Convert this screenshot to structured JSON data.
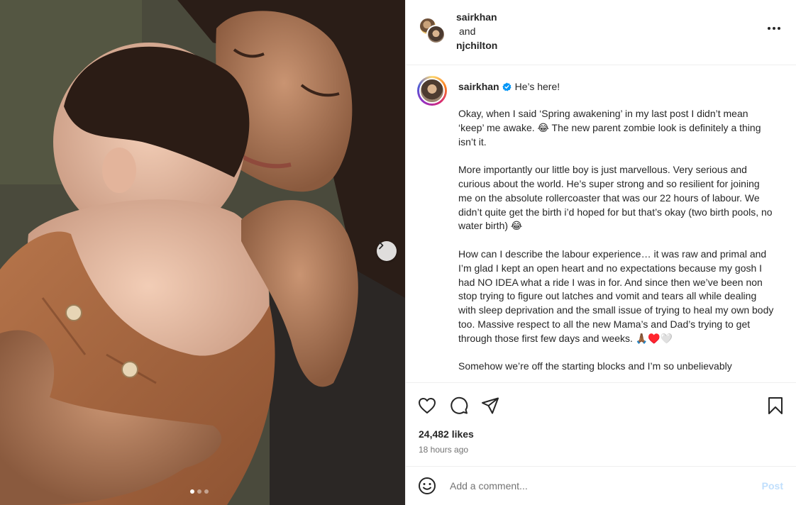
{
  "media": {
    "carousel_pages": 3,
    "current_page": 1
  },
  "header": {
    "user1": "sairkhan",
    "joiner": "and",
    "user2": "njchilton"
  },
  "caption": {
    "username": "sairkhan",
    "first_line": "He’s here!",
    "body": "Okay, when I said ‘Spring awakening’ in my last post I didn’t mean ‘keep’ me awake. 😂 The new parent zombie look is definitely a thing isn’t it.\n\nMore importantly our little boy is just marvellous. Very serious and curious about the world. He’s super strong and so resilient for joining me on the absolute rollercoaster that was our 22 hours of labour. We didn’t quite get the birth i’d hoped for but that’s okay (two birth pools, no water birth) 😂\n\nHow can I describe the labour experience… it was raw and primal and I’m glad I kept an open heart and no expectations because my gosh I had NO IDEA what a ride I was in for. And since then we’ve been non stop trying to figure out latches and vomit and tears all while dealing with sleep deprivation and the small issue of trying to heal my own body too. Massive respect to all the new Mama’s and Dad’s trying to get through those first few days and weeks. 🙏🏾♥️🤍\n\nSomehow we’re off the starting blocks and I’m so unbelievably"
  },
  "stats": {
    "likes": "24,482 likes",
    "time": "18 hours ago"
  },
  "comment": {
    "placeholder": "Add a comment...",
    "post_label": "Post"
  },
  "colors": {
    "verified": "#0095f6",
    "post_disabled": "#c0dffd",
    "border": "#efefef"
  },
  "icons": [
    "chevron-right-icon",
    "more-icon",
    "verified-icon",
    "heart-icon",
    "comment-icon",
    "share-icon",
    "bookmark-icon",
    "emoji-icon"
  ]
}
